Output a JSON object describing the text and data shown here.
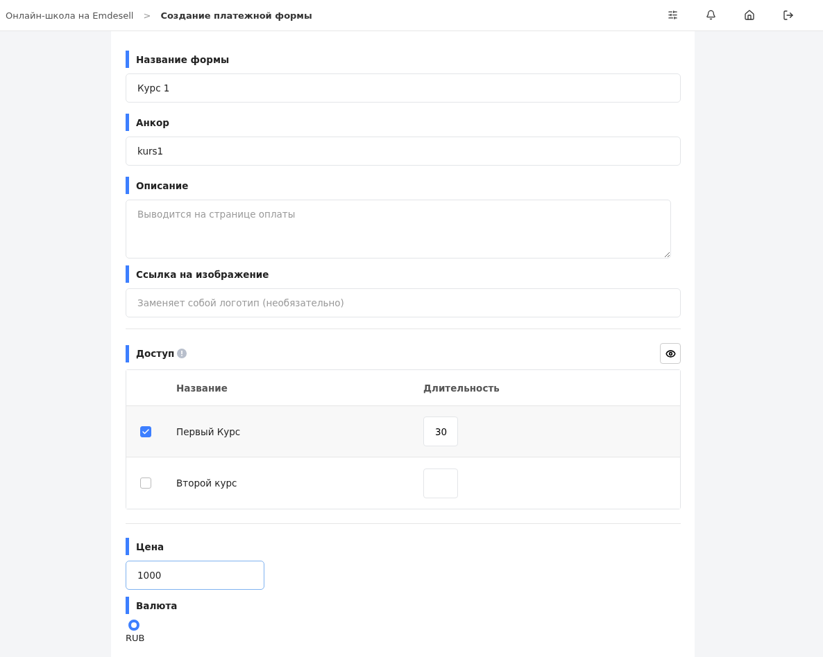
{
  "breadcrumb": {
    "parent": "Онлайн-школа на Emdesell",
    "separator": ">",
    "current": "Создание платежной формы"
  },
  "fields": [
    {
      "kind": "input",
      "label": "Название формы",
      "value": "Курс 1"
    },
    {
      "kind": "input",
      "label": "Анкор",
      "value": "kurs1"
    },
    {
      "kind": "textarea",
      "label": "Описание",
      "placeholder": "Выводится на странице оплаты"
    },
    {
      "kind": "input",
      "label": "Ссылка на изображение",
      "placeholder": "Заменяет собой логотип (необязательно)"
    }
  ],
  "access": {
    "label": "Доступ",
    "columns": [
      "Название",
      "Длительность"
    ],
    "rows": [
      {
        "checked": true,
        "name": "Первый Курс",
        "duration": "30"
      },
      {
        "checked": false,
        "name": "Второй курс",
        "duration": ""
      }
    ]
  },
  "price": {
    "label": "Цена",
    "value": "1000",
    "focused": true
  },
  "currency": {
    "label": "Валюта",
    "options": [
      {
        "label": "RUB",
        "selected": true
      }
    ]
  }
}
